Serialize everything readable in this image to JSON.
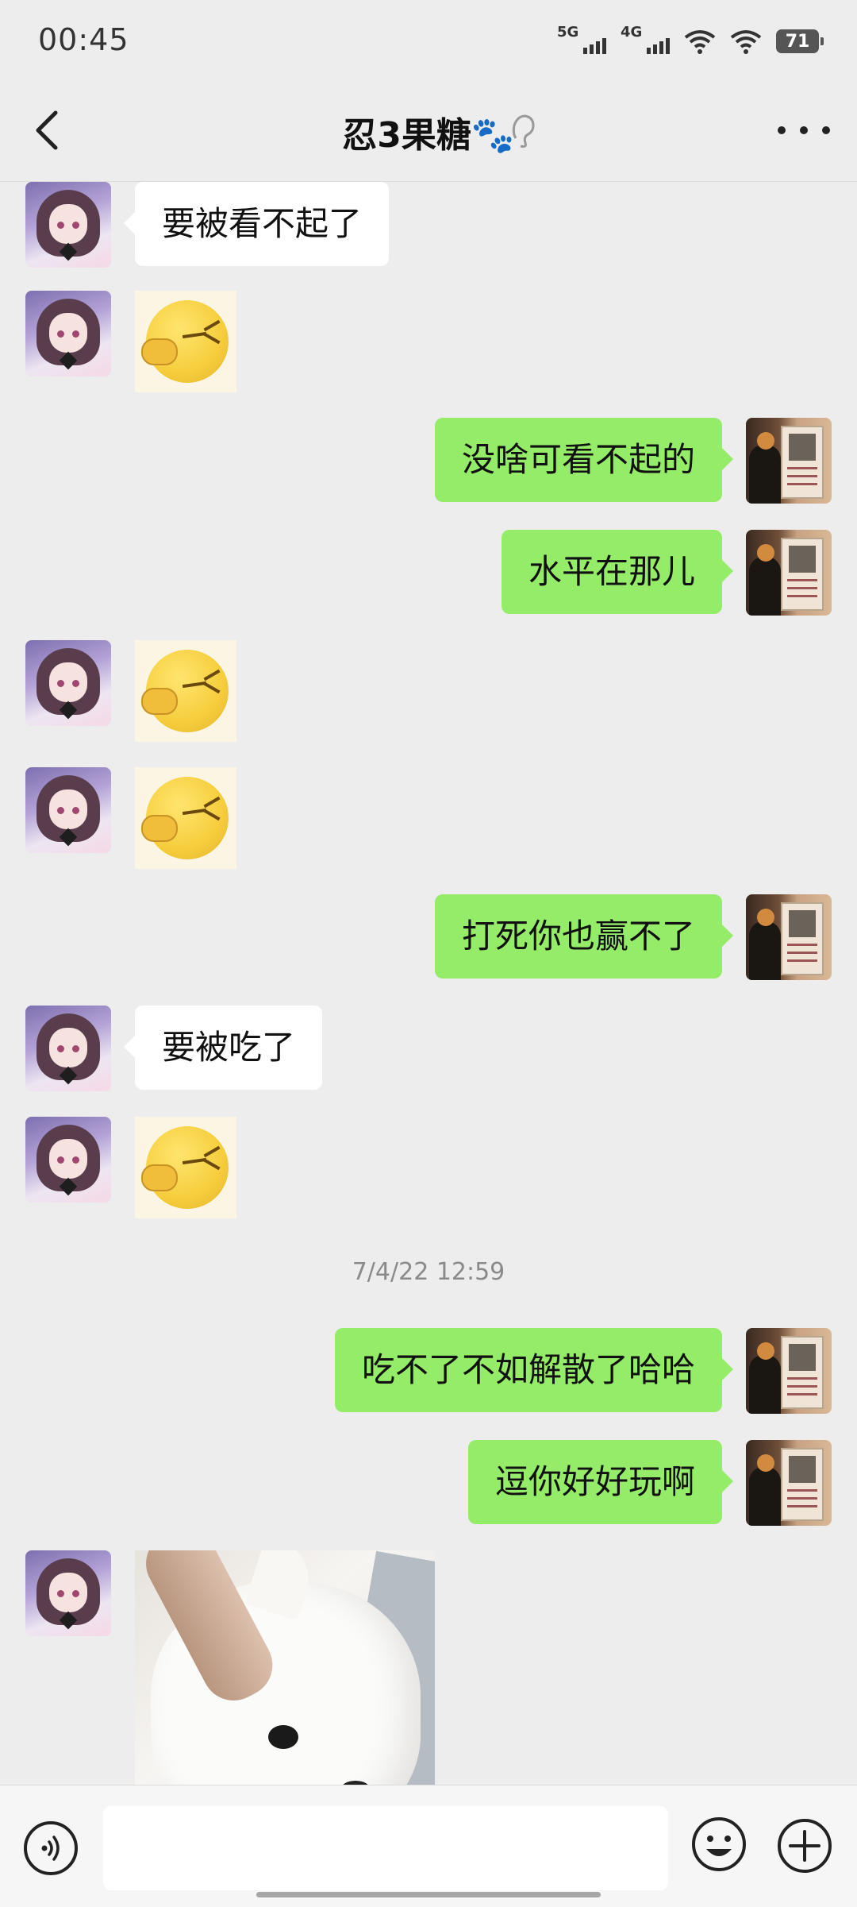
{
  "status_bar": {
    "time": "00:45",
    "network_1": "5G",
    "network_2": "4G",
    "battery": "71"
  },
  "header": {
    "title": "忍3果糖🐾"
  },
  "messages": [
    {
      "side": "left",
      "type": "text",
      "text": "要被看不起了"
    },
    {
      "side": "left",
      "type": "sticker",
      "sticker": "emoji-facepalm-sticker"
    },
    {
      "side": "right",
      "type": "text",
      "text": "没啥可看不起的"
    },
    {
      "side": "right",
      "type": "text",
      "text": "水平在那儿"
    },
    {
      "side": "left",
      "type": "sticker",
      "sticker": "emoji-facepalm-sticker"
    },
    {
      "side": "left",
      "type": "sticker",
      "sticker": "emoji-facepalm-sticker"
    },
    {
      "side": "right",
      "type": "text",
      "text": "打死你也赢不了"
    },
    {
      "side": "left",
      "type": "text",
      "text": "要被吃了"
    },
    {
      "side": "left",
      "type": "sticker",
      "sticker": "emoji-facepalm-sticker"
    },
    {
      "type": "timestamp",
      "text": "7/4/22 12:59"
    },
    {
      "side": "right",
      "type": "text",
      "text": "吃不了不如解散了哈哈"
    },
    {
      "side": "right",
      "type": "text",
      "text": "逗你好好玩啊"
    },
    {
      "side": "left",
      "type": "image",
      "image": "white-dog-photo"
    }
  ],
  "input": {
    "value": ""
  },
  "colors": {
    "background": "#ededed",
    "sent_bubble": "#95ec69",
    "received_bubble": "#ffffff"
  }
}
